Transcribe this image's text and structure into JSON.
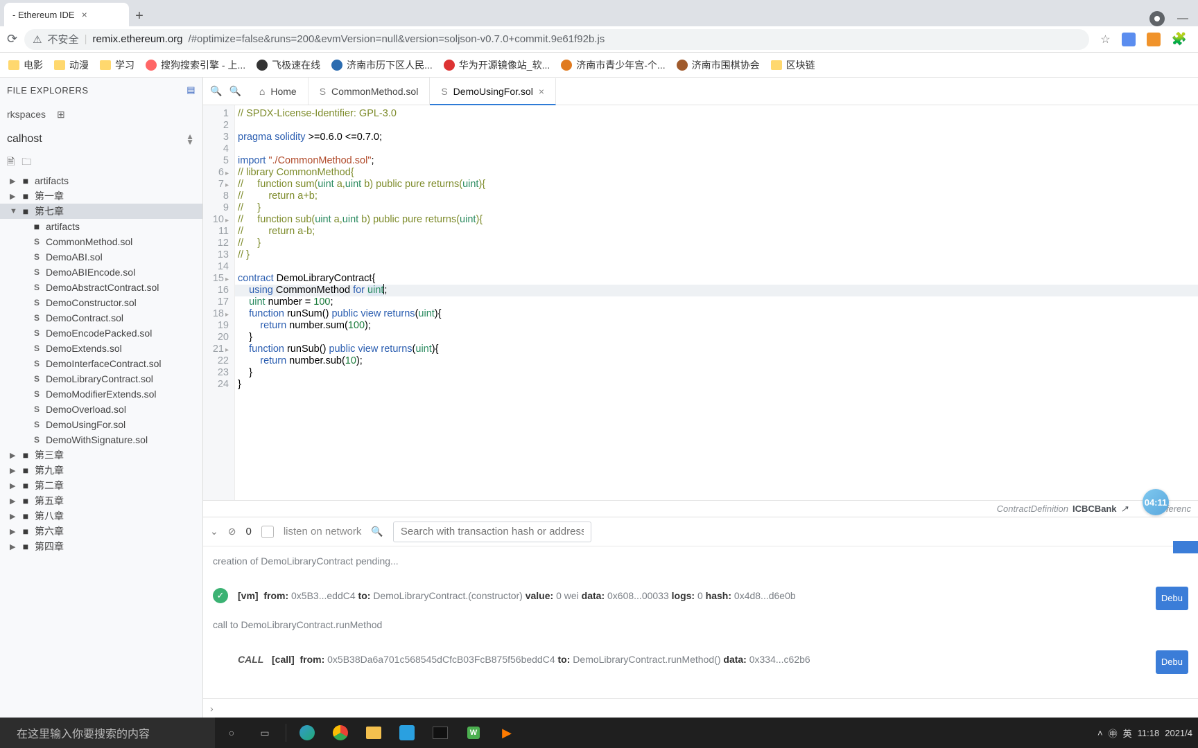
{
  "browser": {
    "tab_title": "- Ethereum IDE",
    "url_not_secure": "不安全",
    "url_domain": "remix.ethereum.org",
    "url_path": "/#optimize=false&runs=200&evmVersion=null&version=soljson-v0.7.0+commit.9e61f92b.js",
    "bookmarks": [
      "电影",
      "动漫",
      "学习",
      "搜狗搜索引擎 - 上...",
      "飞极速在线",
      "济南市历下区人民...",
      "华为开源镜像站_软...",
      "济南市青少年宫-个...",
      "济南市围棋协会",
      "区块链"
    ]
  },
  "side": {
    "title": "FILE EXPLORERS",
    "workspaces_label": "rkspaces",
    "workspace": "calhost",
    "tree": {
      "artifacts": "artifacts",
      "chapter1": "第一章",
      "chapter7": "第七章",
      "c7": {
        "artifacts": "artifacts",
        "files": [
          "CommonMethod.sol",
          "DemoABI.sol",
          "DemoABIEncode.sol",
          "DemoAbstractContract.sol",
          "DemoConstructor.sol",
          "DemoContract.sol",
          "DemoEncodePacked.sol",
          "DemoExtends.sol",
          "DemoInterfaceContract.sol",
          "DemoLibraryContract.sol",
          "DemoModifierExtends.sol",
          "DemoOverload.sol",
          "DemoUsingFor.sol",
          "DemoWithSignature.sol"
        ]
      },
      "rest": [
        "第三章",
        "第九章",
        "第二章",
        "第五章",
        "第八章",
        "第六章",
        "第四章"
      ]
    }
  },
  "tabs": {
    "home": "Home",
    "t1": "CommonMethod.sol",
    "t2": "DemoUsingFor.sol"
  },
  "code": {
    "lines": [
      {
        "n": 1,
        "t": "// SPDX-License-Identifier: GPL-3.0",
        "c": "cmt"
      },
      {
        "n": 2,
        "t": ""
      },
      {
        "n": 3,
        "html": "<span class='c-kw'>pragma</span> <span class='c-kw'>solidity</span> &gt;=0.6.0 &lt;=0.7.0;"
      },
      {
        "n": 4,
        "t": ""
      },
      {
        "n": 5,
        "html": "<span class='c-kw'>import</span> <span class='c-str'>\"./CommonMethod.sol\"</span>;"
      },
      {
        "n": 6,
        "a": true,
        "html": "<span class='c-cmt'>// library CommonMethod{</span>"
      },
      {
        "n": 7,
        "a": true,
        "html": "<span class='c-cmt'>//     function sum(</span><span class='c-ty'>uint</span><span class='c-cmt'> a,</span><span class='c-ty'>uint</span><span class='c-cmt'> b) public pure returns(</span><span class='c-ty'>uint</span><span class='c-cmt'>){</span>"
      },
      {
        "n": 8,
        "html": "<span class='c-cmt'>//         return a+b;</span>"
      },
      {
        "n": 9,
        "html": "<span class='c-cmt'>//     }</span>"
      },
      {
        "n": 10,
        "a": true,
        "html": "<span class='c-cmt'>//     function sub(</span><span class='c-ty'>uint</span><span class='c-cmt'> a,</span><span class='c-ty'>uint</span><span class='c-cmt'> b) public pure returns(</span><span class='c-ty'>uint</span><span class='c-cmt'>){</span>"
      },
      {
        "n": 11,
        "html": "<span class='c-cmt'>//         return a-b;</span>"
      },
      {
        "n": 12,
        "html": "<span class='c-cmt'>//     }</span>"
      },
      {
        "n": 13,
        "html": "<span class='c-cmt'>// }</span>"
      },
      {
        "n": 14,
        "t": ""
      },
      {
        "n": 15,
        "a": true,
        "html": "<span class='c-kw'>contract</span> DemoLibraryContract{"
      },
      {
        "n": 16,
        "hl": true,
        "html": "    <span class='c-kw'>using</span> CommonMethod <span class='c-kw'>for</span> <span class='c-ty word-hl'>uint</span><span class='csr'></span>;"
      },
      {
        "n": 17,
        "html": "    <span class='c-ty'>uint</span> number = <span class='c-num'>100</span>;"
      },
      {
        "n": 18,
        "a": true,
        "html": "    <span class='c-kw'>function</span> runSum() <span class='c-kw'>public</span> <span class='c-kw'>view</span> <span class='c-kw'>returns</span>(<span class='c-ty'>uint</span>){"
      },
      {
        "n": 19,
        "html": "        <span class='c-kw'>return</span> number.sum(<span class='c-num'>100</span>);"
      },
      {
        "n": 20,
        "html": "    }"
      },
      {
        "n": 21,
        "a": true,
        "html": "    <span class='c-kw'>function</span> runSub() <span class='c-kw'>public</span> <span class='c-kw'>view</span> <span class='c-kw'>returns</span>(<span class='c-ty'>uint</span>){"
      },
      {
        "n": 22,
        "html": "        <span class='c-kw'>return</span> number.sub(<span class='c-num'>10</span>);"
      },
      {
        "n": 23,
        "html": "    }"
      },
      {
        "n": 24,
        "html": "}"
      }
    ]
  },
  "status": {
    "scope": "ContractDefinition",
    "name": "ICBCBank",
    "refs": "0 referenc"
  },
  "term": {
    "count": "0",
    "listen": "listen on network",
    "search_ph": "Search with transaction hash or address",
    "l1": "creation of DemoLibraryContract pending...",
    "tx": {
      "vm": "[vm]",
      "from_l": "from:",
      "from": "0x5B3...eddC4",
      "to_l": "to:",
      "to": "DemoLibraryContract.(constructor)",
      "value_l": "value:",
      "value": "0 wei",
      "data_l": "data:",
      "data": "0x608...00033",
      "logs_l": "logs:",
      "logs": "0",
      "hash_l": "hash:",
      "hash": "0x4d8...d6e0b"
    },
    "l3": "call to DemoLibraryContract.runMethod",
    "call": {
      "tag": "CALL",
      "call": "[call]",
      "from_l": "from:",
      "from": "0x5B38Da6a701c568545dCfcB03FcB875f56beddC4",
      "to_l": "to:",
      "to": "DemoLibraryContract.runMethod()",
      "data_l": "data:",
      "data": "0x334...c62b6"
    },
    "debug": "Debu"
  },
  "bubble": "04:11",
  "taskbar": {
    "search_ph": "在这里输入你要搜索的内容",
    "time": "11:18",
    "date": "2021/4"
  }
}
